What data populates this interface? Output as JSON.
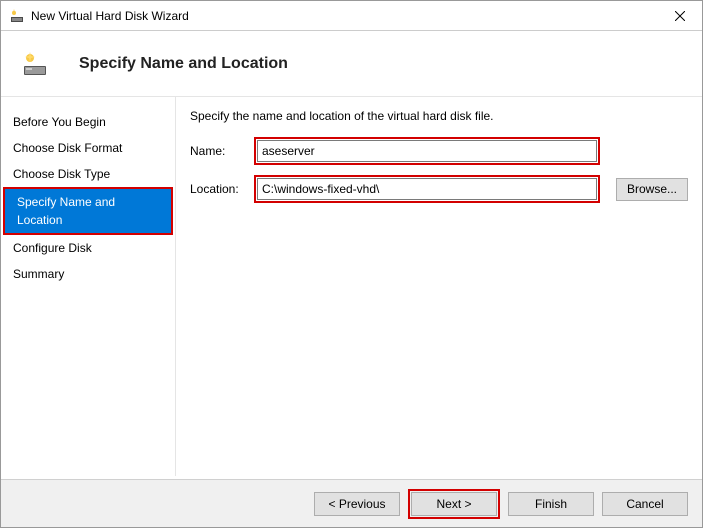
{
  "window": {
    "title": "New Virtual Hard Disk Wizard"
  },
  "header": {
    "title": "Specify Name and Location"
  },
  "sidebar": {
    "steps": [
      "Before You Begin",
      "Choose Disk Format",
      "Choose Disk Type",
      "Specify Name and Location",
      "Configure Disk",
      "Summary"
    ]
  },
  "main": {
    "instruction": "Specify the name and location of the virtual hard disk file.",
    "name_label": "Name:",
    "name_value": "aseserver",
    "location_label": "Location:",
    "location_value": "C:\\windows-fixed-vhd\\",
    "browse_label": "Browse..."
  },
  "footer": {
    "previous": "< Previous",
    "next": "Next >",
    "finish": "Finish",
    "cancel": "Cancel"
  }
}
